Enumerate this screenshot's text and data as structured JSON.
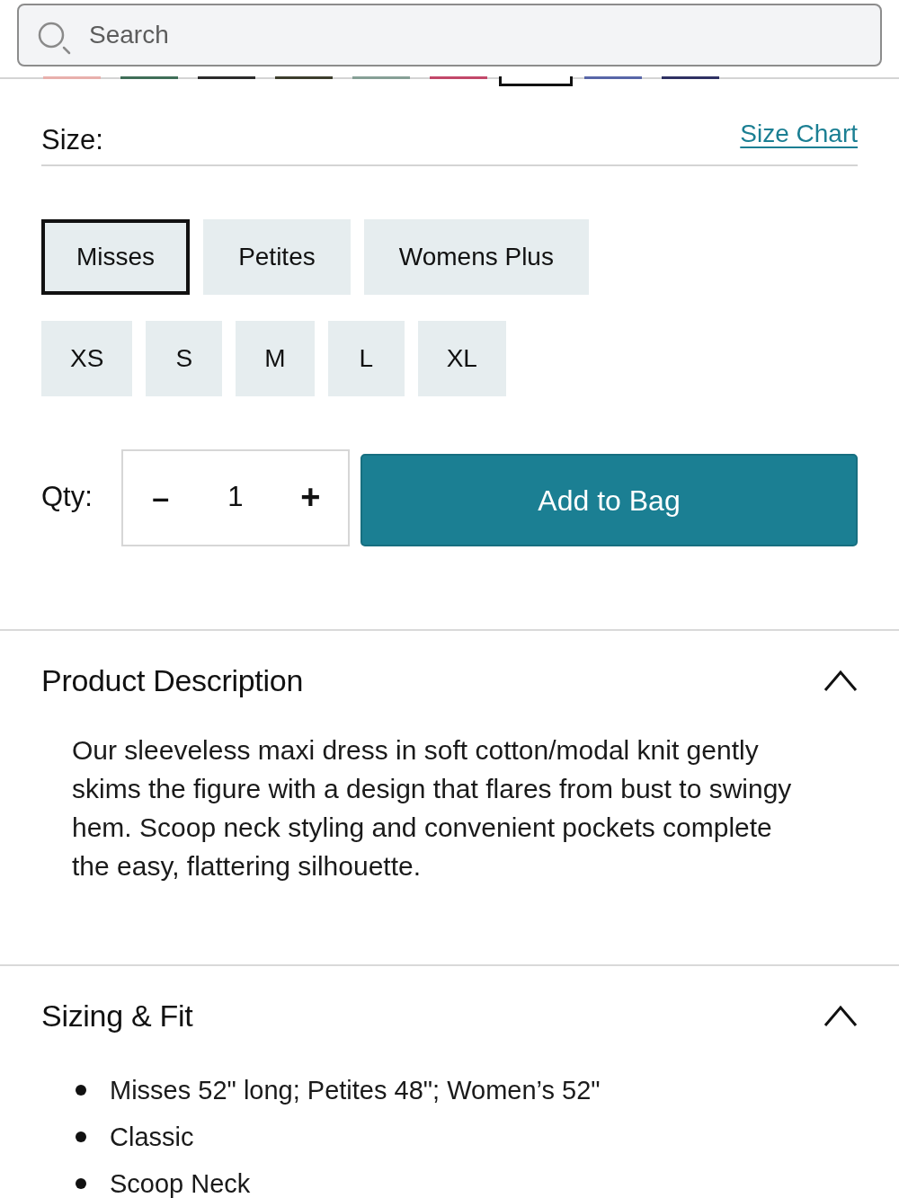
{
  "search": {
    "placeholder": "Search"
  },
  "color_swatches": [
    {
      "color": "#e8b0ac",
      "selected": false
    },
    {
      "color": "#3f6e58",
      "selected": false
    },
    {
      "color": "#2b2b2b",
      "selected": false
    },
    {
      "color": "#3c3d2c",
      "selected": false
    },
    {
      "color": "#86a096",
      "selected": false
    },
    {
      "color": "#c2486a",
      "selected": false
    },
    {
      "color": "#ffffff",
      "selected": true
    },
    {
      "color": "#5866a8",
      "selected": false
    },
    {
      "color": "#2f3163",
      "selected": false
    }
  ],
  "size": {
    "label": "Size:",
    "size_chart_link": "Size Chart",
    "fit_options": [
      {
        "label": "Misses",
        "selected": true
      },
      {
        "label": "Petites",
        "selected": false
      },
      {
        "label": "Womens Plus",
        "selected": false
      }
    ],
    "size_options": [
      {
        "label": "XS",
        "selected": false
      },
      {
        "label": "S",
        "selected": false
      },
      {
        "label": "M",
        "selected": false
      },
      {
        "label": "L",
        "selected": false
      },
      {
        "label": "XL",
        "selected": false
      }
    ]
  },
  "quantity": {
    "label": "Qty:",
    "decrement": "–",
    "value": "1",
    "increment": "+"
  },
  "add_to_bag": "Add to Bag",
  "sections": [
    {
      "kind": "paragraph",
      "title": "Product Description",
      "expanded": true,
      "text": "Our sleeveless maxi dress in soft cotton/modal knit gently skims the figure with a design that flares from bust to swingy hem. Scoop neck styling and convenient pockets complete the easy, flattering silhouette."
    },
    {
      "kind": "bullets",
      "title": "Sizing & Fit",
      "expanded": true,
      "items": [
        "Misses 52\" long; Petites 48\"; Women’s 52\"",
        "Classic",
        "Scoop Neck"
      ]
    }
  ]
}
